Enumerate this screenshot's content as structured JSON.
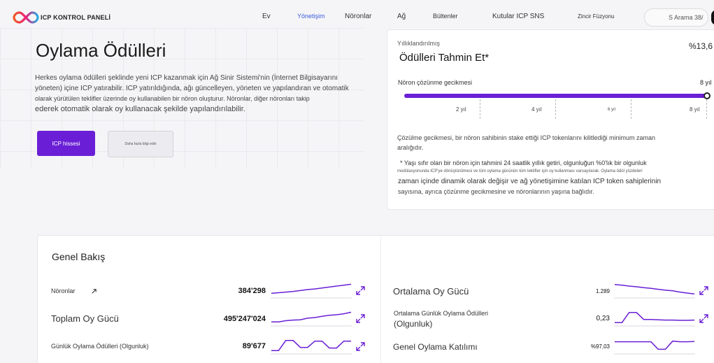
{
  "header": {
    "logo_text": "ICP KONTROL PANELİ",
    "nav": [
      {
        "label": "Ev",
        "active": false
      },
      {
        "label": "Yönetişim",
        "active": true
      },
      {
        "label": "Nöronlar",
        "active": false
      },
      {
        "label": "Ağ",
        "active": false
      },
      {
        "label": "Bültenler",
        "active": false
      },
      {
        "label": "Kutular ICP SNS",
        "active": false
      },
      {
        "label": "Zincir Füzyonu",
        "active": false
      }
    ],
    "search_label": "S Arama 38/"
  },
  "hero": {
    "title": "Oylama Ödülleri",
    "desc_line1": "Herkes oylama ödülleri şeklinde yeni ICP kazanmak için Ağ Sinir Sistemi'nin (İnternet Bilgisayarını",
    "desc_line2": "yöneten) içine ICP yatırabilir. ICP yatırıldığında, ağı güncelleyen, yöneten ve yapılandıran ve otomatik",
    "desc_line3": "olarak yürütülen teklifler üzerinde oy kullanabilen bir nöron oluşturur. Nöronlar, diğer nöronları takip",
    "desc_line4": "ederek otomatik olarak oy kullanacak şekilde yapılandırılabilir.",
    "primary_button": "ICP hissesi",
    "secondary_button": "Daha fazla bilgi edin"
  },
  "estimator": {
    "label": "Yıllıklandırılmış",
    "title": "Ödülleri Tahmin Et*",
    "percent": "%13,6",
    "slider_label": "Nöron çözünme gecikmesi",
    "slider_value": "8 yıl",
    "slider_fraction": 1.0,
    "ticks": [
      "2 yıl",
      "4 yıl",
      "6 yıl",
      "8 yıl"
    ],
    "note1": "Çözülme gecikmesi, bir nöron sahibinin stake ettiği ICP tokenlarını kilitlediği minimum zaman aralığıdır.",
    "note2": "* Yaşı sıfır olan bir nöron için tahmini 24 saatlik yıllık getiri, olgunluğun %0'lık bir olgunluk",
    "note3": "modülasyonunda ICP'ye dönüştürülmesi ve tüm oylama gücünün tüm teklifler için oy kullanması varsayılarak. Oylama ödül yüzdeleri",
    "note4a": "zaman içinde dinamik olarak değişir ve ağ yönetişimine katılan ICP token sahiplerinin",
    "note4b": "sayısına, ayrıca çözünme gecikmesine ve nöronlarının yaşına bağlıdır."
  },
  "overview": {
    "title": "Genel Bakış",
    "left": [
      {
        "label": "Nöronlar",
        "value": "384'298",
        "trend": [
          0.2,
          0.25,
          0.3,
          0.35,
          0.42,
          0.5,
          0.55,
          0.62,
          0.7,
          0.78,
          0.85,
          0.92
        ]
      },
      {
        "label": "Toplam Oy Gücü",
        "value": "495'247'024",
        "trend": [
          0.15,
          0.15,
          0.25,
          0.3,
          0.32,
          0.45,
          0.5,
          0.6,
          0.68,
          0.72,
          0.8,
          0.92
        ]
      },
      {
        "label": "Günlük Oylama Ödülleri (Olgunluk)",
        "value": "89'677",
        "trend": [
          0.1,
          0.1,
          0.9,
          0.9,
          0.35,
          0.35,
          0.85,
          0.85,
          0.3,
          0.3,
          0.85,
          0.85
        ]
      }
    ],
    "right": [
      {
        "label": "Ortalama Oy Gücü",
        "value": "1.289",
        "trend": [
          0.9,
          0.85,
          0.78,
          0.72,
          0.65,
          0.6,
          0.52,
          0.45,
          0.4,
          0.3,
          0.22,
          0.15
        ]
      },
      {
        "label": "Ortalama Günlük Oylama Ödülleri",
        "label2": "(Olgunluk)",
        "value": "0,23",
        "trend": [
          0.1,
          0.1,
          0.9,
          0.9,
          0.35,
          0.35,
          0.32,
          0.3,
          0.3,
          0.28,
          0.28,
          0.3
        ]
      },
      {
        "label": "Genel Oylama Katılımı",
        "value": "%97,03",
        "trend": [
          0.8,
          0.8,
          0.8,
          0.8,
          0.8,
          0.8,
          0.2,
          0.2,
          0.85,
          0.8,
          0.8,
          0.82
        ]
      }
    ]
  },
  "colors": {
    "accent": "#6a1fd6",
    "link": "#3b5bdb"
  }
}
